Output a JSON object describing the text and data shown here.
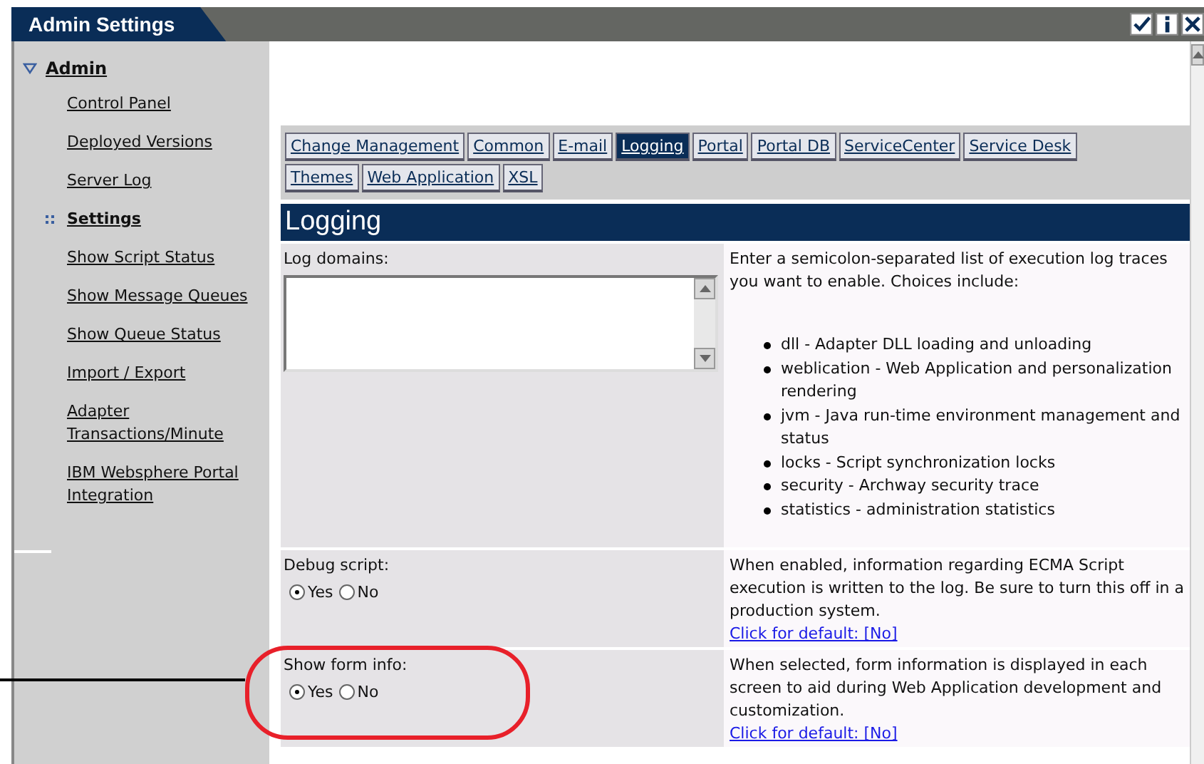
{
  "window": {
    "title": "Admin Settings"
  },
  "sidebar": {
    "section": {
      "label": "Admin",
      "expanded": true
    },
    "items": [
      {
        "label": "Control Panel",
        "selected": false
      },
      {
        "label": "Deployed Versions",
        "selected": false
      },
      {
        "label": "Server Log",
        "selected": false
      },
      {
        "label": "Settings",
        "selected": true
      },
      {
        "label": "Show Script Status",
        "selected": false
      },
      {
        "label": "Show Message Queues",
        "selected": false
      },
      {
        "label": "Show Queue Status",
        "selected": false
      },
      {
        "label": "Import / Export",
        "selected": false
      },
      {
        "label": "Adapter Transactions/Minute",
        "selected": false
      },
      {
        "label": "IBM Websphere Portal Integration",
        "selected": false
      }
    ]
  },
  "tab_rows": [
    [
      {
        "label": "Change Management",
        "selected": false
      },
      {
        "label": "Common",
        "selected": false
      },
      {
        "label": "E-mail",
        "selected": false
      },
      {
        "label": "Logging",
        "selected": true
      },
      {
        "label": "Portal",
        "selected": false
      },
      {
        "label": "Portal DB",
        "selected": false
      },
      {
        "label": "ServiceCenter",
        "selected": false
      },
      {
        "label": "Service Desk",
        "selected": false
      }
    ],
    [
      {
        "label": "Themes",
        "selected": false
      },
      {
        "label": "Web Application",
        "selected": false
      },
      {
        "label": "XSL",
        "selected": false
      }
    ]
  ],
  "panel": {
    "title": "Logging",
    "settings": [
      {
        "kind": "textarea",
        "label": "Log domains:",
        "description": "Enter a semicolon-separated list of execution log traces you want to enable. Choices include:",
        "choices": [
          "dll - Adapter DLL loading and unloading",
          "weblication - Web Application and personalization rendering",
          "jvm - Java run-time environment management and status",
          "locks - Script synchronization locks",
          "security - Archway security trace",
          "statistics - administration statistics"
        ]
      },
      {
        "kind": "radio",
        "label": "Debug script:",
        "options": [
          {
            "label": "Yes",
            "selected": true
          },
          {
            "label": "No",
            "selected": false
          }
        ],
        "description": "When enabled, information regarding ECMA Script execution is written to the log. Be sure to turn this off in a production system.",
        "link": "Click for default: [No]"
      },
      {
        "kind": "radio",
        "label": "Show form info:",
        "highlighted": true,
        "options": [
          {
            "label": "Yes",
            "selected": true
          },
          {
            "label": "No",
            "selected": false
          }
        ],
        "description": "When selected, form information is displayed in each screen to aid during Web Application development and customization.",
        "link": "Click for default: [No]"
      }
    ]
  }
}
